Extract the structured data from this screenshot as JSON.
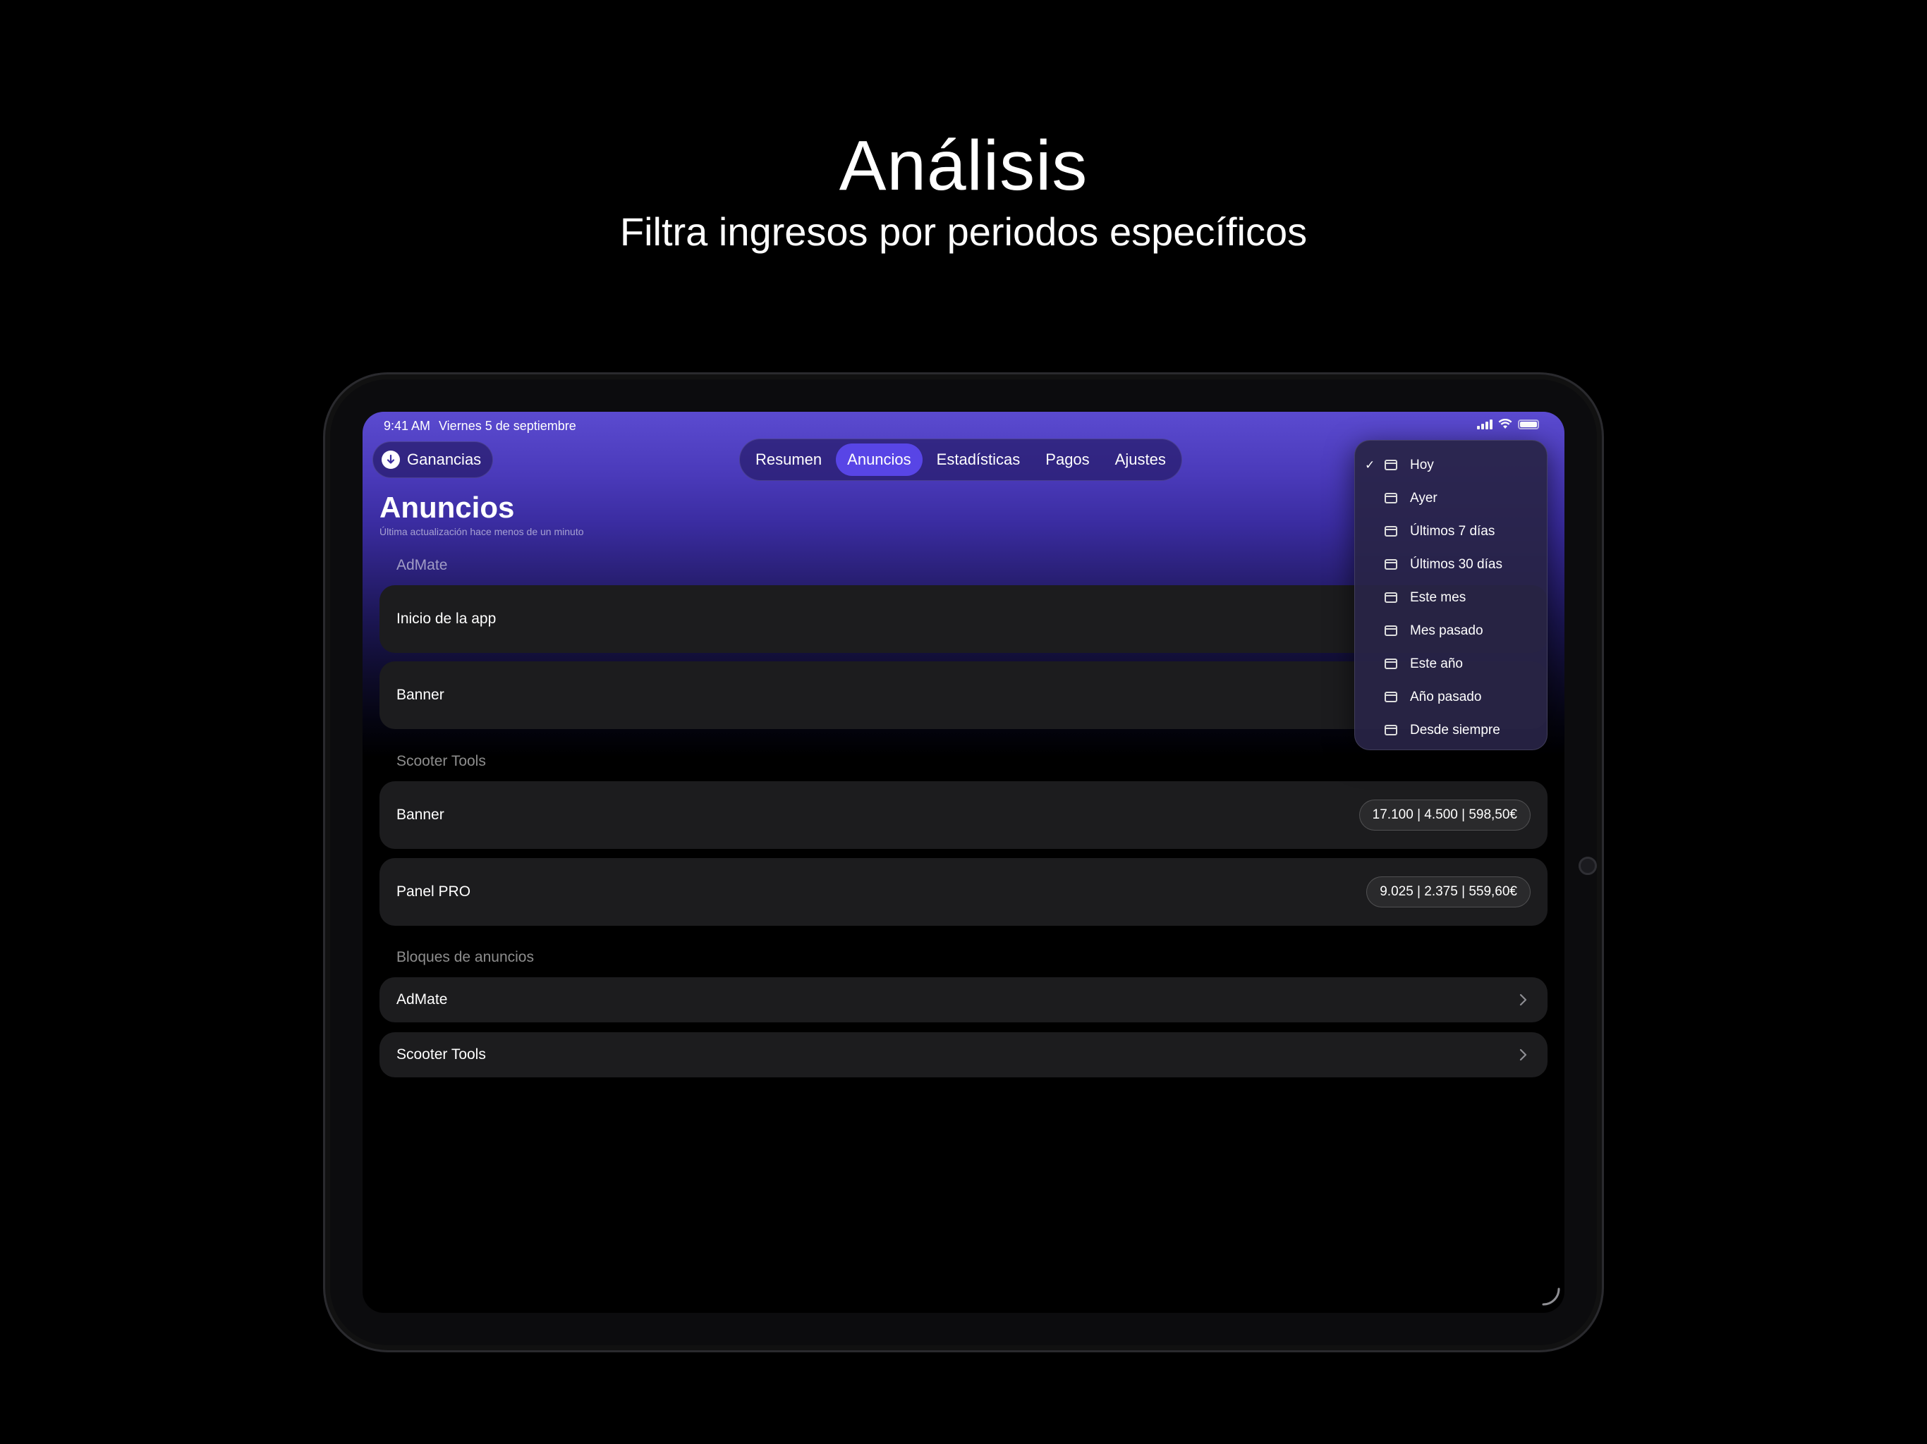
{
  "hero": {
    "title": "Análisis",
    "subtitle": "Filtra ingresos por periodos específicos"
  },
  "status_bar": {
    "time": "9:41 AM",
    "date": "Viernes 5 de septiembre"
  },
  "back_button": {
    "label": "Ganancias"
  },
  "tabs": [
    {
      "label": "Resumen",
      "active": false
    },
    {
      "label": "Anuncios",
      "active": true
    },
    {
      "label": "Estadísticas",
      "active": false
    },
    {
      "label": "Pagos",
      "active": false
    },
    {
      "label": "Ajustes",
      "active": false
    }
  ],
  "page": {
    "title": "Anuncios",
    "subtitle": "Última actualización hace menos de un minuto"
  },
  "sections": [
    {
      "label": "AdMate",
      "rows": [
        {
          "label": "Inicio de la app"
        },
        {
          "label": "Banner"
        }
      ]
    },
    {
      "label": "Scooter Tools",
      "rows": [
        {
          "label": "Banner",
          "stats": "17.100 | 4.500 | 598,50€"
        },
        {
          "label": "Panel PRO",
          "stats": "9.025 | 2.375 | 559,60€"
        }
      ]
    },
    {
      "label": "Bloques de anuncios",
      "rows": [
        {
          "label": "AdMate"
        },
        {
          "label": "Scooter Tools"
        }
      ]
    }
  ],
  "period_menu": {
    "selected": "Hoy",
    "items": [
      "Hoy",
      "Ayer",
      "Últimos 7 días",
      "Últimos 30 días",
      "Este mes",
      "Mes pasado",
      "Este año",
      "Año pasado",
      "Desde siempre"
    ]
  },
  "colors": {
    "accent": "#5845e6",
    "card": "#1c1c1e",
    "background": "#000000"
  }
}
